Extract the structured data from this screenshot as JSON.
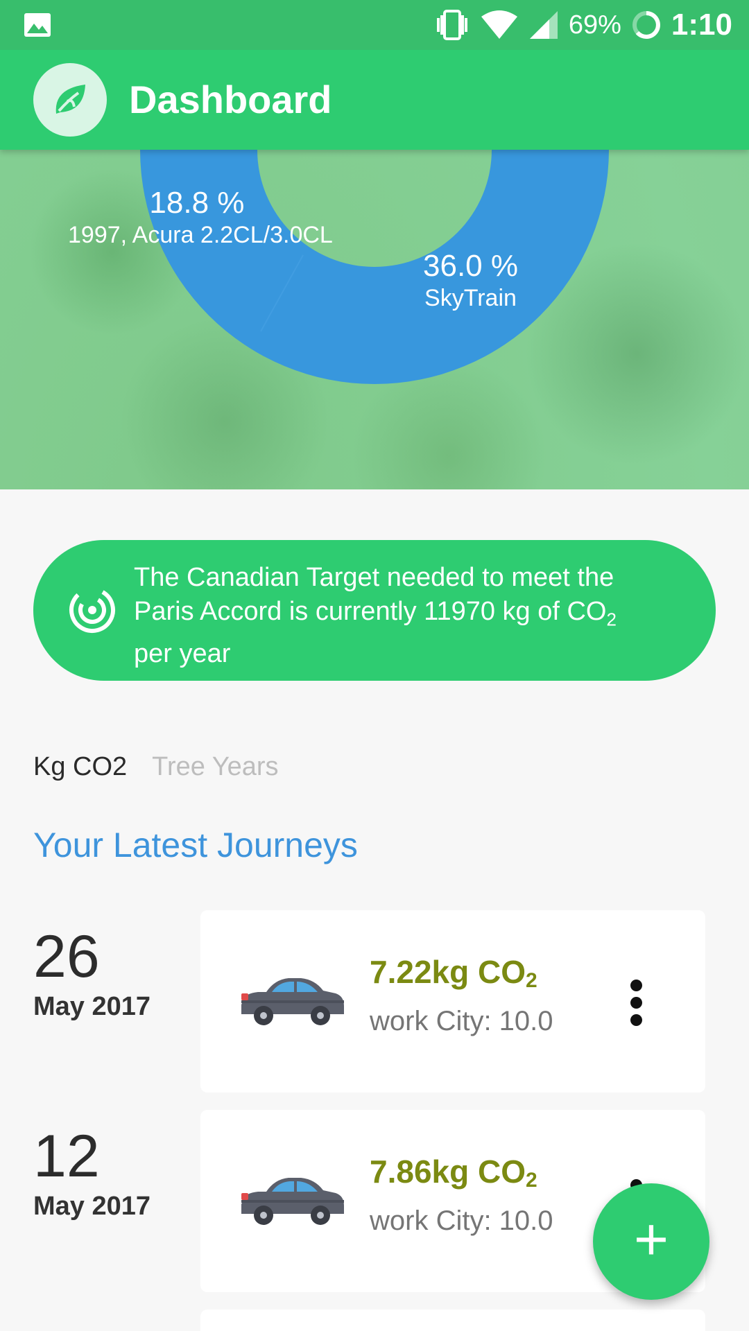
{
  "status_bar": {
    "battery": "69%",
    "time": "1:10",
    "icons": [
      "image-icon",
      "vibrate-icon",
      "wifi-icon",
      "signal-icon",
      "battery-icon"
    ]
  },
  "app_bar": {
    "title": "Dashboard",
    "logo_icon": "leaf-icon"
  },
  "chart_data": {
    "type": "pie",
    "slices": [
      {
        "label": "1997, Acura 2.2CL/3.0CL",
        "value": 18.8,
        "display": "18.8 %"
      },
      {
        "label": "SkyTrain",
        "value": 36.0,
        "display": "36.0 %"
      }
    ],
    "colors": {
      "slice": "#3897dd"
    }
  },
  "target_banner": {
    "text_line1": "The Canadian Target needed to meet the",
    "text_line2": "Paris Accord is currently 11970 kg of CO",
    "text_sub": "2",
    "text_line3": "per year",
    "icon": "target-icon"
  },
  "tabs": [
    {
      "label": "Kg CO2",
      "active": true
    },
    {
      "label": "Tree Years",
      "active": false
    }
  ],
  "section_title": "Your Latest Journeys",
  "journeys": [
    {
      "day": "26",
      "month": "May 2017",
      "amount": "7.22kg CO",
      "amount_sub": "2",
      "description": "work City: 10.0",
      "vehicle_icon": "car-icon"
    },
    {
      "day": "12",
      "month": "May 2017",
      "amount": "7.86kg CO",
      "amount_sub": "2",
      "description": "work City: 10.0",
      "vehicle_icon": "car-icon"
    }
  ],
  "fab": {
    "label": "+"
  },
  "colors": {
    "primary": "#2ecc71",
    "status_bar": "#38be6c",
    "accent_blue": "#3e94dc",
    "amount_olive": "#7b8a12"
  }
}
